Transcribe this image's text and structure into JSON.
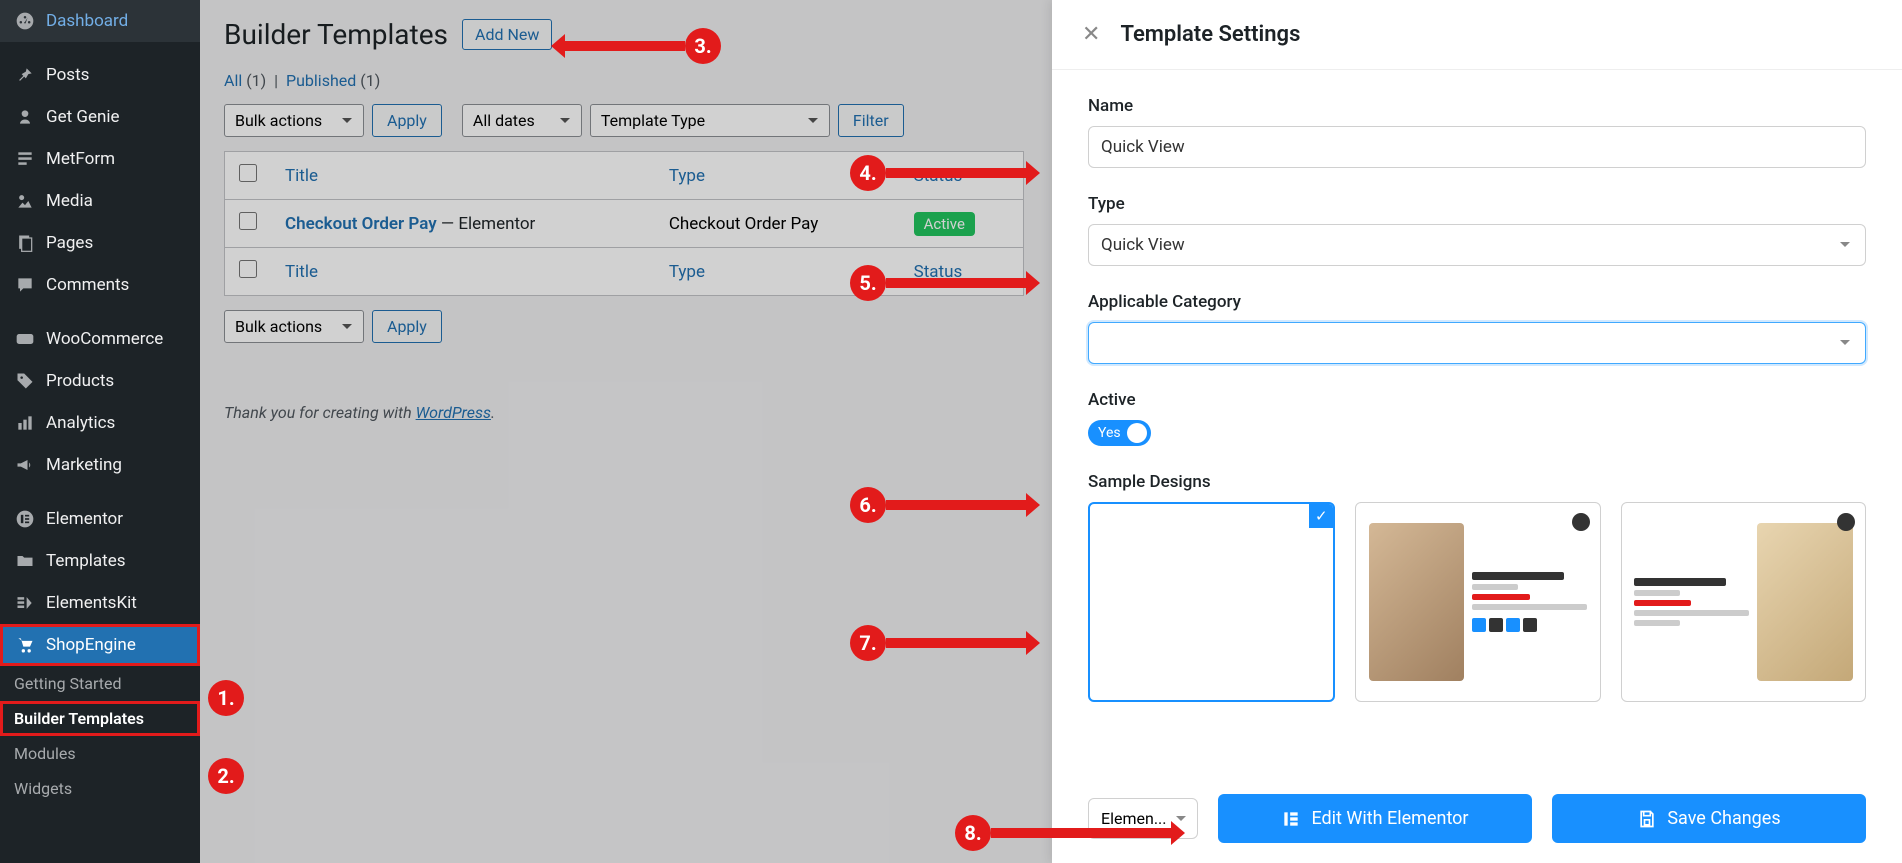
{
  "sidebar": {
    "items": [
      {
        "label": "Dashboard",
        "icon": "gauge"
      },
      {
        "label": "Posts",
        "icon": "pin"
      },
      {
        "label": "Get Genie",
        "icon": "genie"
      },
      {
        "label": "MetForm",
        "icon": "form"
      },
      {
        "label": "Media",
        "icon": "media"
      },
      {
        "label": "Pages",
        "icon": "pages"
      },
      {
        "label": "Comments",
        "icon": "comments"
      },
      {
        "label": "WooCommerce",
        "icon": "woo"
      },
      {
        "label": "Products",
        "icon": "products"
      },
      {
        "label": "Analytics",
        "icon": "analytics"
      },
      {
        "label": "Marketing",
        "icon": "marketing"
      },
      {
        "label": "Elementor",
        "icon": "elementor"
      },
      {
        "label": "Templates",
        "icon": "templates"
      },
      {
        "label": "ElementsKit",
        "icon": "ek"
      },
      {
        "label": "ShopEngine",
        "icon": "se"
      }
    ],
    "sub_items": [
      {
        "label": "Getting Started"
      },
      {
        "label": "Builder Templates"
      },
      {
        "label": "Modules"
      },
      {
        "label": "Widgets"
      }
    ]
  },
  "main": {
    "title": "Builder Templates",
    "add_new": "Add New",
    "filters": {
      "all": "All",
      "all_count": "(1)",
      "sep": "|",
      "published": "Published",
      "pub_count": "(1)"
    },
    "bulk_actions": "Bulk actions",
    "apply": "Apply",
    "all_dates": "All dates",
    "template_type": "Template Type",
    "filter": "Filter",
    "columns": {
      "title": "Title",
      "type": "Type",
      "status": "Status"
    },
    "rows": [
      {
        "title": "Checkout Order Pay",
        "suffix": " — Elementor",
        "type": "Checkout Order Pay",
        "status": "Active"
      }
    ],
    "footer_text": "Thank you for creating with ",
    "footer_link": "WordPress"
  },
  "panel": {
    "title": "Template Settings",
    "name_label": "Name",
    "name_value": "Quick View",
    "type_label": "Type",
    "type_value": "Quick View",
    "category_label": "Applicable Category",
    "active_label": "Active",
    "active_value": "Yes",
    "sample_label": "Sample Designs",
    "editor_value": "Elemen...",
    "edit_btn": "Edit With Elementor",
    "save_btn": "Save Changes"
  },
  "annotations": [
    "1.",
    "2.",
    "3.",
    "4.",
    "5.",
    "6.",
    "7.",
    "8."
  ]
}
